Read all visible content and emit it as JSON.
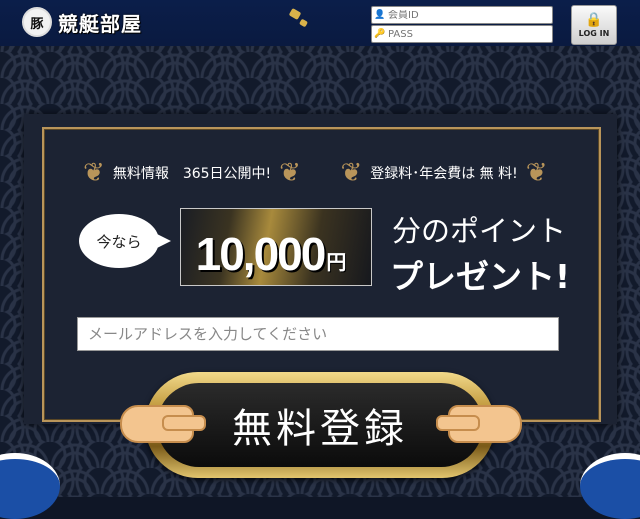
{
  "header": {
    "logo_mark": "豚",
    "logo_text": "競艇部屋",
    "member_id_placeholder": "会員ID",
    "pass_placeholder": "PASS",
    "login_label": "LOG IN"
  },
  "badges": [
    {
      "text": "無料情報　365日公開中!"
    },
    {
      "text": "登録料･年会費は 無 料!"
    }
  ],
  "promo": {
    "bubble": "今なら",
    "amount": "10,000",
    "unit": "円",
    "line1": "分のポイント",
    "line2": "プレゼント!"
  },
  "form": {
    "email_placeholder": "メールアドレスを入力してください",
    "register_label": "無料登録"
  },
  "colors": {
    "header_bg": "#0b1e4a",
    "gold": "#b9955a",
    "panel_bg": "#1c2333"
  }
}
